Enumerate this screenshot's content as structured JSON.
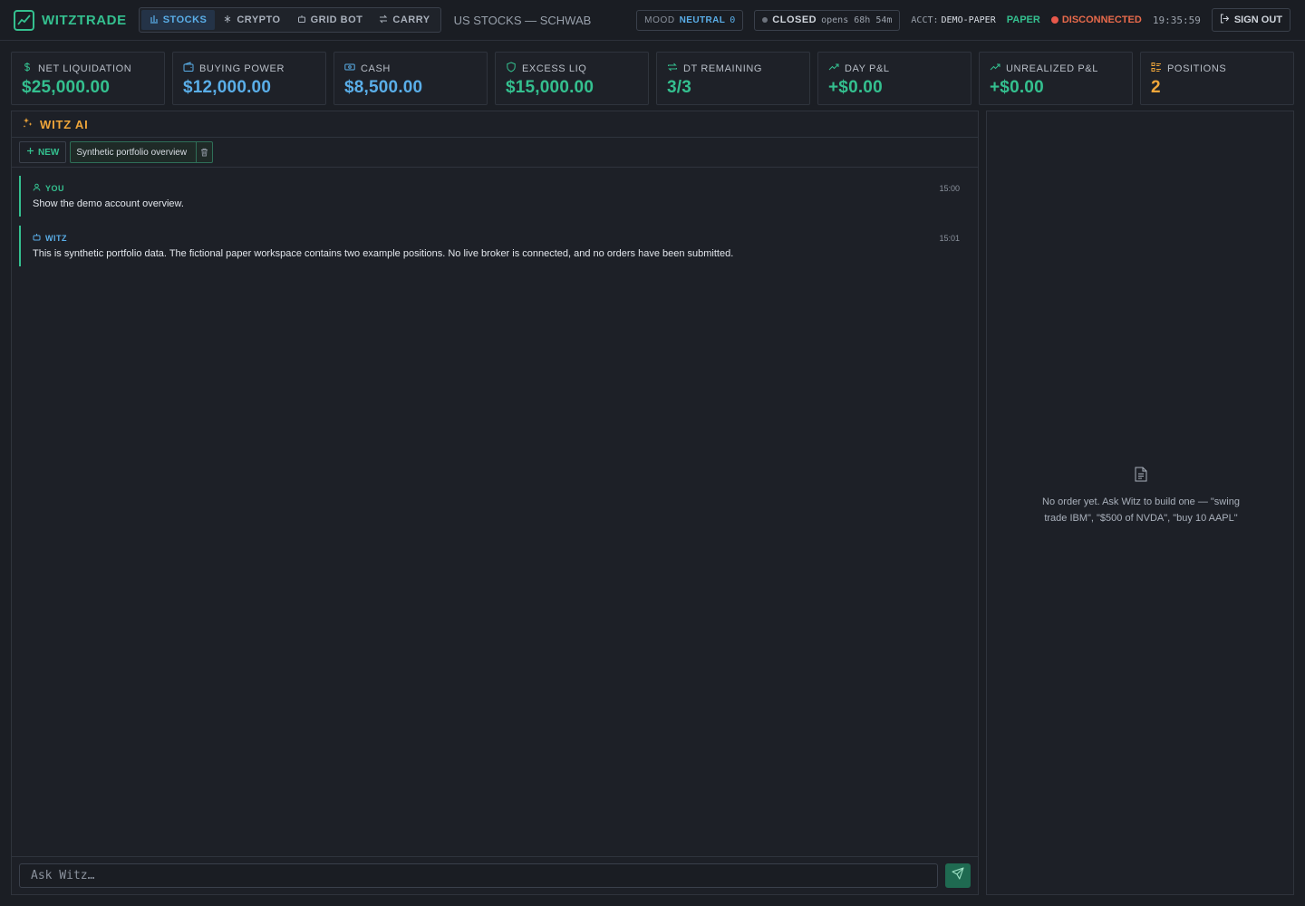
{
  "app": {
    "name": "WITZTRADE"
  },
  "nav": {
    "tabs": [
      {
        "label": "STOCKS",
        "icon": "bar-chart-icon",
        "active": true
      },
      {
        "label": "CRYPTO",
        "icon": "crypto-icon",
        "active": false
      },
      {
        "label": "GRID BOT",
        "icon": "bot-icon",
        "active": false
      },
      {
        "label": "CARRY",
        "icon": "swap-icon",
        "active": false
      }
    ],
    "venue": "US STOCKS — SCHWAB"
  },
  "status": {
    "mood_label": "MOOD",
    "mood_value": "NEUTRAL",
    "mood_score": "0",
    "market_state": "CLOSED",
    "market_opens": "opens 68h 54m",
    "acct_label": "ACCT:",
    "acct_value": "DEMO-PAPER",
    "mode": "PAPER",
    "connection": "DISCONNECTED",
    "clock": "19:35:59",
    "signout": "SIGN OUT"
  },
  "stats": [
    {
      "label": "NET LIQUIDATION",
      "value": "$25,000.00",
      "icon": "dollar-icon",
      "color": "#34c08f"
    },
    {
      "label": "BUYING POWER",
      "value": "$12,000.00",
      "icon": "wallet-icon",
      "color": "#5aaee8"
    },
    {
      "label": "CASH",
      "value": "$8,500.00",
      "icon": "banknote-icon",
      "color": "#5aaee8"
    },
    {
      "label": "EXCESS LIQ",
      "value": "$15,000.00",
      "icon": "shield-icon",
      "color": "#34c08f"
    },
    {
      "label": "DT REMAINING",
      "value": "3/3",
      "icon": "repeat-icon",
      "color": "#34c08f"
    },
    {
      "label": "DAY P&L",
      "value": "+$0.00",
      "icon": "trend-up-icon",
      "color": "#34c08f"
    },
    {
      "label": "UNREALIZED P&L",
      "value": "+$0.00",
      "icon": "trend-up-icon",
      "color": "#34c08f"
    },
    {
      "label": "POSITIONS",
      "value": "2",
      "icon": "list-icon",
      "color": "#f0a63a"
    }
  ],
  "chat": {
    "title": "WITZ AI",
    "new_label": "NEW",
    "session_label": "Synthetic portfolio overview",
    "messages": [
      {
        "who": "YOU",
        "time": "15:00",
        "text": "Show the demo account overview."
      },
      {
        "who": "WITZ",
        "time": "15:01",
        "text": "This is synthetic portfolio data. The fictional paper workspace contains two example positions. No live broker is connected, and no orders have been submitted."
      }
    ],
    "input_placeholder": "Ask Witz…"
  },
  "order": {
    "empty_text": "No order yet. Ask Witz to build one — \"swing trade IBM\", \"$500 of NVDA\", \"buy 10 AAPL\""
  },
  "colors": {
    "accent_green": "#34c08f",
    "accent_blue": "#5aaee8",
    "accent_orange": "#f0a63a",
    "danger": "#e86a4b"
  }
}
